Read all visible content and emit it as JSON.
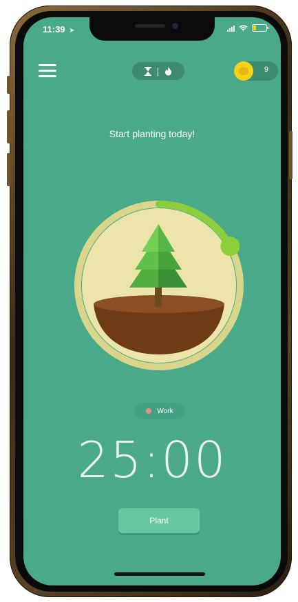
{
  "status_bar": {
    "time": "11:39",
    "location_icon": "location-arrow-icon"
  },
  "header": {
    "menu_icon": "hamburger-menu-icon",
    "mode_timer_icon": "hourglass-icon",
    "mode_separator": "|",
    "mode_alt_icon": "flame-icon",
    "coins": "9",
    "coin_icon": "coin-icon"
  },
  "main": {
    "headline": "Start planting today!",
    "tag_label": "Work",
    "timer": "25:00",
    "plant_button": "Plant",
    "progress_fraction": 0.17
  },
  "colors": {
    "screen_bg": "#4aa988",
    "ring_track": "#d9d68c",
    "ring_progress": "#8ccf3a",
    "circle_fill": "#ece4a8",
    "soil": "#6d3c16",
    "tree": "#4fae3f",
    "coin": "#f4d21b",
    "tag_dot": "#f28b8b"
  }
}
